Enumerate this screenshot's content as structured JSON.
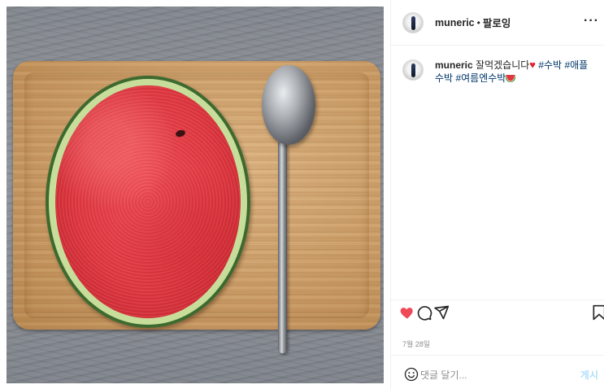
{
  "post": {
    "username": "muneric",
    "separator": "•",
    "follow_label": "팔로잉",
    "more_label": "···",
    "caption": {
      "username": "muneric",
      "text": "잘먹겠습니다",
      "hashtags": [
        "#수박",
        "#애플수박",
        "#여름엔수박"
      ]
    },
    "date": "7월 28일",
    "comment_placeholder": "댓글 달기...",
    "post_button": "게시"
  },
  "icons": {
    "like": "heart-filled-icon",
    "comment": "speech-bubble-icon",
    "share": "paper-plane-icon",
    "save": "bookmark-icon",
    "emoji": "smiley-icon"
  },
  "colors": {
    "like_red": "#ed4956",
    "hashtag_blue": "#00376b",
    "post_button": "#b2dffc",
    "meta_gray": "#8e8e8e"
  }
}
